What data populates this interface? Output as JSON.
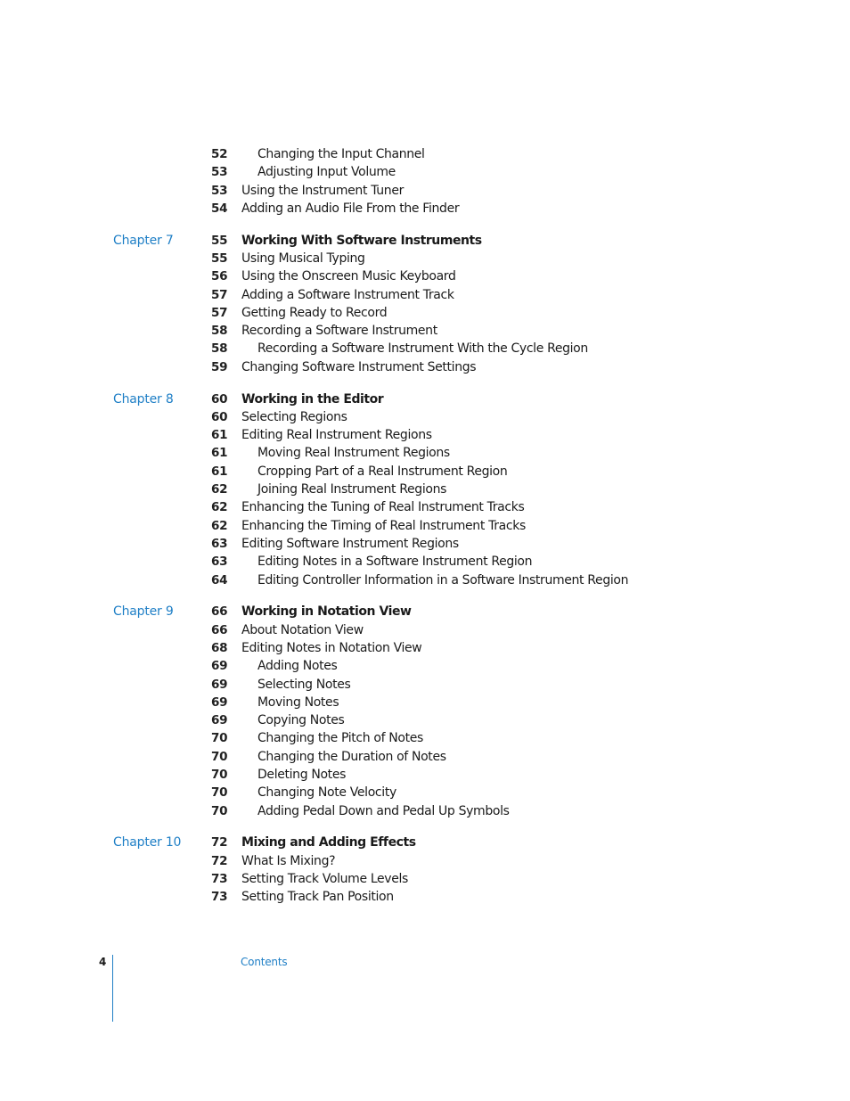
{
  "toc": {
    "sections": [
      {
        "chapter": "",
        "entries": [
          {
            "page": "52",
            "title": "Changing the Input Channel",
            "level": 2
          },
          {
            "page": "53",
            "title": "Adjusting Input Volume",
            "level": 2
          },
          {
            "page": "53",
            "title": "Using the Instrument Tuner",
            "level": 1
          },
          {
            "page": "54",
            "title": "Adding an Audio File From the Finder",
            "level": 1
          }
        ]
      },
      {
        "chapter": "Chapter 7",
        "entries": [
          {
            "page": "55",
            "title": "Working With Software Instruments",
            "level": 0
          },
          {
            "page": "55",
            "title": "Using Musical Typing",
            "level": 1
          },
          {
            "page": "56",
            "title": "Using the Onscreen Music Keyboard",
            "level": 1
          },
          {
            "page": "57",
            "title": "Adding a Software Instrument Track",
            "level": 1
          },
          {
            "page": "57",
            "title": "Getting Ready to Record",
            "level": 1
          },
          {
            "page": "58",
            "title": "Recording a Software Instrument",
            "level": 1
          },
          {
            "page": "58",
            "title": "Recording a Software Instrument With the Cycle Region",
            "level": 2
          },
          {
            "page": "59",
            "title": "Changing Software Instrument Settings",
            "level": 1
          }
        ]
      },
      {
        "chapter": "Chapter 8",
        "entries": [
          {
            "page": "60",
            "title": "Working in the Editor",
            "level": 0
          },
          {
            "page": "60",
            "title": "Selecting Regions",
            "level": 1
          },
          {
            "page": "61",
            "title": "Editing Real Instrument Regions",
            "level": 1
          },
          {
            "page": "61",
            "title": "Moving Real Instrument Regions",
            "level": 2
          },
          {
            "page": "61",
            "title": "Cropping Part of a Real Instrument Region",
            "level": 2
          },
          {
            "page": "62",
            "title": "Joining Real Instrument Regions",
            "level": 2
          },
          {
            "page": "62",
            "title": "Enhancing the Tuning of Real Instrument Tracks",
            "level": 1
          },
          {
            "page": "62",
            "title": "Enhancing the Timing of Real Instrument Tracks",
            "level": 1
          },
          {
            "page": "63",
            "title": "Editing Software Instrument Regions",
            "level": 1
          },
          {
            "page": "63",
            "title": "Editing Notes in a Software Instrument Region",
            "level": 2
          },
          {
            "page": "64",
            "title": "Editing Controller Information in a Software Instrument Region",
            "level": 2
          }
        ]
      },
      {
        "chapter": "Chapter 9",
        "entries": [
          {
            "page": "66",
            "title": "Working in Notation View",
            "level": 0
          },
          {
            "page": "66",
            "title": "About Notation View",
            "level": 1
          },
          {
            "page": "68",
            "title": "Editing Notes in Notation View",
            "level": 1
          },
          {
            "page": "69",
            "title": "Adding Notes",
            "level": 2
          },
          {
            "page": "69",
            "title": "Selecting Notes",
            "level": 2
          },
          {
            "page": "69",
            "title": "Moving Notes",
            "level": 2
          },
          {
            "page": "69",
            "title": "Copying Notes",
            "level": 2
          },
          {
            "page": "70",
            "title": "Changing the Pitch of Notes",
            "level": 2
          },
          {
            "page": "70",
            "title": "Changing the Duration of Notes",
            "level": 2
          },
          {
            "page": "70",
            "title": "Deleting Notes",
            "level": 2
          },
          {
            "page": "70",
            "title": "Changing Note Velocity",
            "level": 2
          },
          {
            "page": "70",
            "title": "Adding Pedal Down and Pedal Up Symbols",
            "level": 2
          }
        ]
      },
      {
        "chapter": "Chapter 10",
        "entries": [
          {
            "page": "72",
            "title": "Mixing and Adding Effects",
            "level": 0
          },
          {
            "page": "72",
            "title": "What Is Mixing?",
            "level": 1
          },
          {
            "page": "73",
            "title": "Setting Track Volume Levels",
            "level": 1
          },
          {
            "page": "73",
            "title": "Setting Track Pan Position",
            "level": 1
          }
        ]
      }
    ]
  },
  "footer": {
    "page_number": "4",
    "section_name": "Contents"
  },
  "colors": {
    "accent": "#1f7fc6",
    "text": "#1a1a1a"
  }
}
